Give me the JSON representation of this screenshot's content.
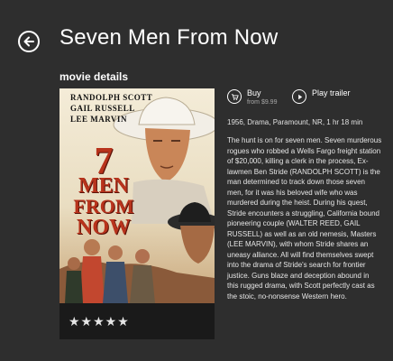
{
  "header": {
    "title": "Seven Men From Now",
    "back_icon": "back-arrow-icon"
  },
  "section": {
    "heading": "movie details"
  },
  "poster": {
    "credits": [
      "RANDOLPH SCOTT",
      "GAIL RUSSELL",
      "LEE MARVIN"
    ],
    "title_art": {
      "num": "7",
      "line1": "MEN",
      "line2": "FROM",
      "line3": "NOW"
    },
    "rating_stars": 5,
    "rating_text": "★★★★★"
  },
  "actions": {
    "buy": {
      "label": "Buy",
      "price": "from $9.99",
      "icon": "cart-icon"
    },
    "trailer": {
      "label": "Play trailer",
      "icon": "play-icon"
    }
  },
  "meta": "1956, Drama, Paramount, NR, 1 hr 18 min",
  "synopsis": "The hunt is on for seven men. Seven murderous rogues who robbed a Wells Fargo freight station of $20,000, killing a clerk in the process, Ex-lawmen Ben Stride (RANDOLPH SCOTT) is the man determined to track down those seven men, for it was his beloved wife who was murdered during the heist. During his quest, Stride encounters a struggling, California bound pioneering couple (WALTER REED, GAIL RUSSELL) as well as an old nemesis, Masters (LEE MARVIN), with whom Stride shares an uneasy alliance. All will find themselves swept into the drama of Stride's search for frontier justice. Guns blaze and deception abound in this rugged drama, with Scott perfectly cast as the stoic, no-nonsense Western hero.",
  "colors": {
    "background": "#2e2e2e",
    "poster_frame": "#1a1a1a",
    "title_art": "#b8331c"
  }
}
